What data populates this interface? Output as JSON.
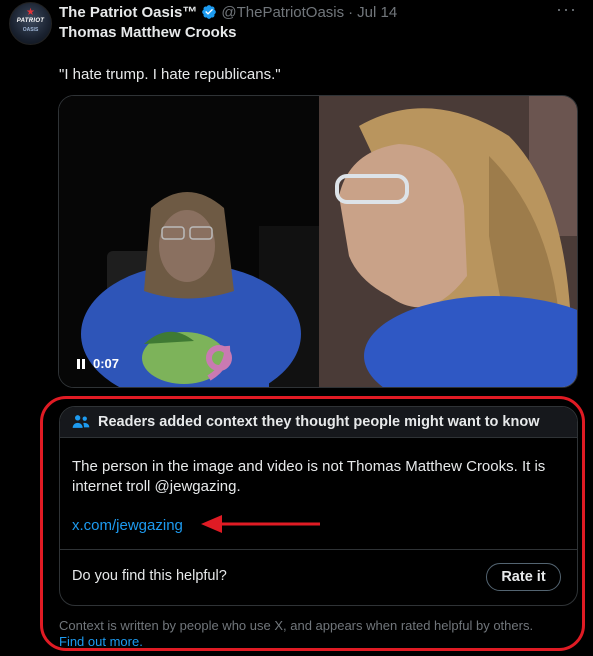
{
  "post": {
    "avatar_text": "PATRIOT",
    "avatar_sub": "OASIS",
    "display_name": "The Patriot Oasis™",
    "handle": "@ThePatriotOasis",
    "separator": "·",
    "date": "Jul 14",
    "more_icon": "more-icon",
    "subject_name": "Thomas Matthew Crooks",
    "text": "\"I hate trump. I hate republicans.\""
  },
  "media": {
    "video_time": "0:07",
    "pause_icon": "pause-icon"
  },
  "community_note": {
    "header_icon": "people-icon",
    "header": "Readers added context they thought people might want to know",
    "body": "The person in the image and video is not Thomas Matthew Crooks. It is internet troll @jewgazing.",
    "link": "x.com/jewgazing",
    "helpful_question": "Do you find this helpful?",
    "rate_label": "Rate it"
  },
  "footer": {
    "text": "Context is written by people who use X, and appears when rated helpful by others.",
    "find_out_more": "Find out more."
  },
  "colors": {
    "background": "#000000",
    "text_primary": "#e7e9ea",
    "text_secondary": "#71767b",
    "link": "#1d9bf0",
    "verified": "#1d9bf0",
    "annotation": "#e01b24"
  }
}
